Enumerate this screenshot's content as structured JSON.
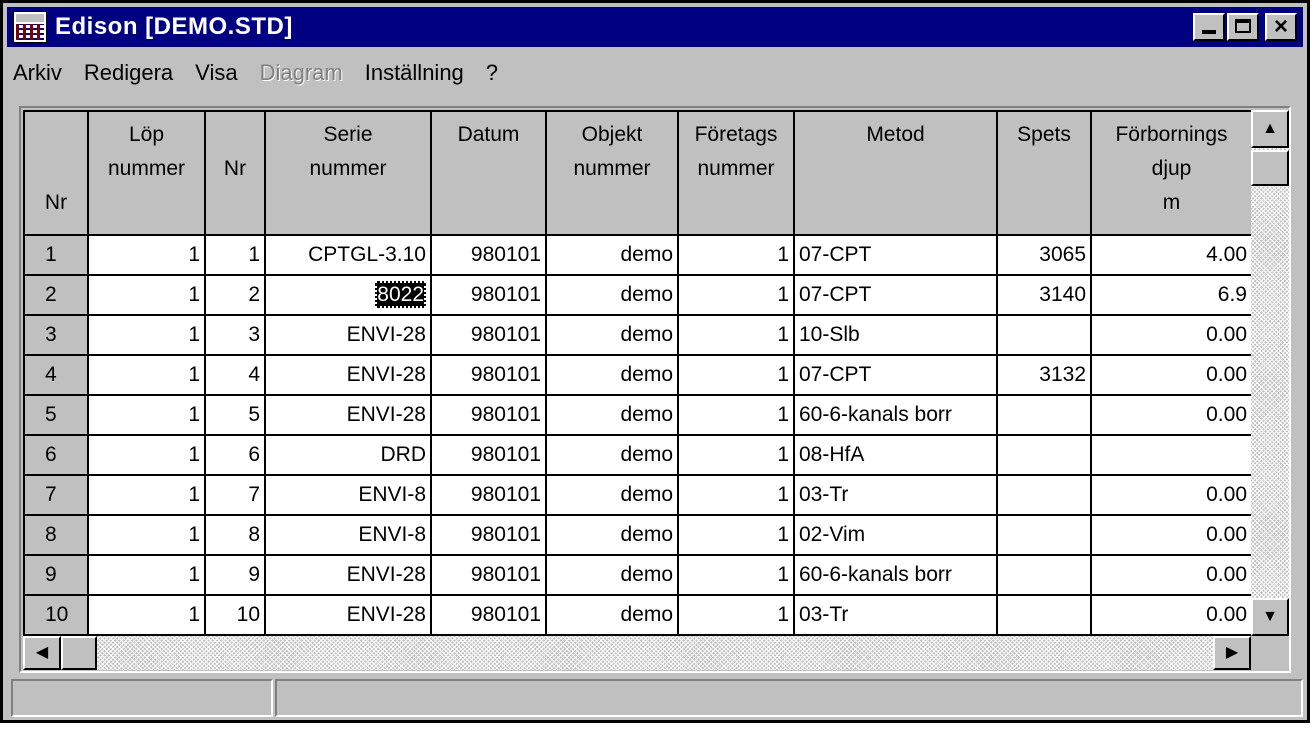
{
  "window": {
    "title": "Edison [DEMO.STD]"
  },
  "icons": {
    "app": "app-icon",
    "minimize": "minimize-icon",
    "maximize": "maximize-icon",
    "close": "close-icon",
    "scroll_up": "scroll-up-icon",
    "scroll_down": "scroll-down-icon",
    "scroll_left": "scroll-left-icon",
    "scroll_right": "scroll-right-icon"
  },
  "title_buttons": {
    "close_glyph": "×"
  },
  "menu": [
    {
      "label": "Arkiv",
      "enabled": true
    },
    {
      "label": "Redigera",
      "enabled": true
    },
    {
      "label": "Visa",
      "enabled": true
    },
    {
      "label": "Diagram",
      "enabled": false
    },
    {
      "label": "Inställning",
      "enabled": true
    },
    {
      "label": "?",
      "enabled": true
    }
  ],
  "table": {
    "headers": [
      [
        "",
        "",
        "Nr"
      ],
      [
        "Löp",
        "nummer",
        ""
      ],
      [
        "",
        "Nr",
        ""
      ],
      [
        "Serie",
        "nummer",
        ""
      ],
      [
        "Datum",
        "",
        ""
      ],
      [
        "Objekt",
        "nummer",
        ""
      ],
      [
        "Företags",
        "nummer",
        ""
      ],
      [
        "Metod",
        "",
        ""
      ],
      [
        "Spets",
        "",
        ""
      ],
      [
        "Förbornings",
        "djup",
        "m"
      ]
    ],
    "rows": [
      [
        "1",
        "1",
        "1",
        "CPTGL-3.10",
        "980101",
        "demo",
        "1",
        "07-CPT",
        "3065",
        "4.00"
      ],
      [
        "2",
        "1",
        "2",
        "8022",
        "980101",
        "demo",
        "1",
        "07-CPT",
        "3140",
        "6.9"
      ],
      [
        "3",
        "1",
        "3",
        "ENVI-28",
        "980101",
        "demo",
        "1",
        "10-Slb",
        "",
        "0.00"
      ],
      [
        "4",
        "1",
        "4",
        "ENVI-28",
        "980101",
        "demo",
        "1",
        "07-CPT",
        "3132",
        "0.00"
      ],
      [
        "5",
        "1",
        "5",
        "ENVI-28",
        "980101",
        "demo",
        "1",
        "60-6-kanals borr",
        "",
        "0.00"
      ],
      [
        "6",
        "1",
        "6",
        "DRD",
        "980101",
        "demo",
        "1",
        "08-HfA",
        "",
        ""
      ],
      [
        "7",
        "1",
        "7",
        "ENVI-8",
        "980101",
        "demo",
        "1",
        "03-Tr",
        "",
        "0.00"
      ],
      [
        "8",
        "1",
        "8",
        "ENVI-8",
        "980101",
        "demo",
        "1",
        "02-Vim",
        "",
        "0.00"
      ],
      [
        "9",
        "1",
        "9",
        "ENVI-28",
        "980101",
        "demo",
        "1",
        "60-6-kanals borr",
        "",
        "0.00"
      ],
      [
        "10",
        "1",
        "10",
        "ENVI-28",
        "980101",
        "demo",
        "1",
        "03-Tr",
        "",
        "0.00"
      ]
    ],
    "selected_cell": {
      "row": 1,
      "col": 3
    }
  },
  "statusbar": {
    "panes": [
      "",
      ""
    ]
  },
  "colors": {
    "titlebar": "#000080",
    "face": "#c0c0c0",
    "selection": "#000000"
  }
}
